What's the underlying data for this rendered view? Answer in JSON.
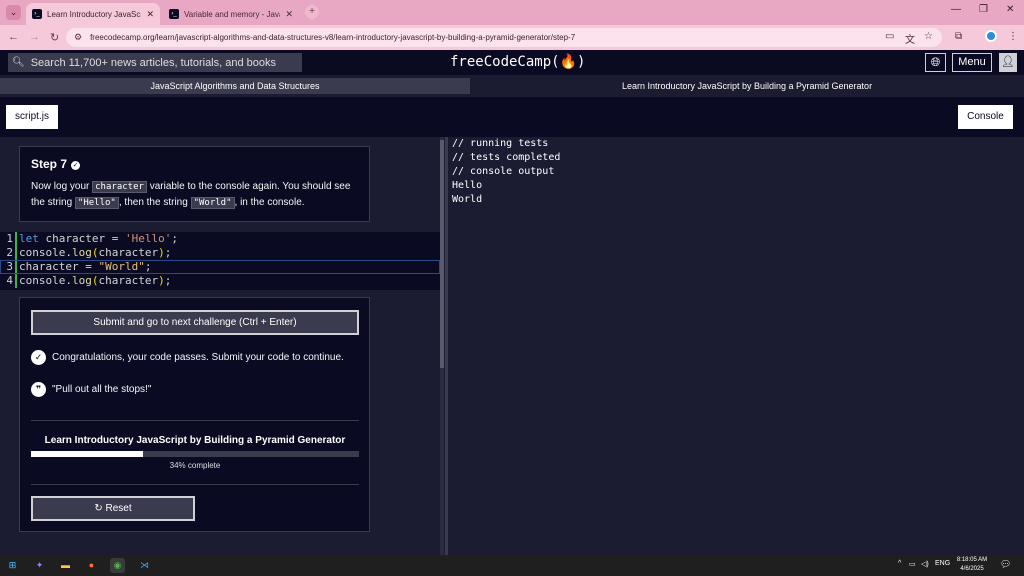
{
  "browser": {
    "tabs": [
      {
        "title": "Learn Introductory JavaScript b",
        "active": true
      },
      {
        "title": "Variable and memory - JavaScri",
        "active": false
      }
    ],
    "url": "freecodecamp.org/learn/javascript-algorithms-and-data-structures-v8/learn-introductory-javascript-by-building-a-pyramid-generator/step-7"
  },
  "nav": {
    "search_placeholder": "Search 11,700+ news articles, tutorials, and books",
    "logo": "freeCodeCamp(🔥)",
    "menu_label": "Menu"
  },
  "breadcrumbs": {
    "superblock": "JavaScript Algorithms and Data Structures",
    "block": "Learn Introductory JavaScript by Building a Pyramid Generator"
  },
  "tabs": {
    "file": "script.js",
    "console": "Console"
  },
  "instructions": {
    "step_title": "Step 7",
    "text_1": "Now log your ",
    "code_1": "character",
    "text_2": " variable to the console again. You should see the string ",
    "code_2": "\"Hello\"",
    "text_3": ", then the string ",
    "code_3": "\"World\"",
    "text_4": ", in the console."
  },
  "editor": {
    "line_numbers": [
      "1",
      "2",
      "3",
      "4"
    ],
    "line1": {
      "kw": "let",
      "rest": " character = ",
      "str": "'Hello'",
      "end": ";"
    },
    "line2": {
      "obj": "console.",
      "fn": "log",
      "open": "(",
      "arg": "character",
      "close": ")",
      "end": ";"
    },
    "line3": {
      "lhs": "character = ",
      "str": "\"World\"",
      "end": ";"
    },
    "line4": {
      "obj": "console.",
      "fn": "log",
      "open": "(",
      "arg": "character",
      "close": ")",
      "end": ";"
    }
  },
  "actions": {
    "submit_label": "Submit and go to next challenge (Ctrl + Enter)",
    "success_message": "Congratulations, your code passes. Submit your code to continue.",
    "quote": "\"Pull out all the stops!\"",
    "progress_title": "Learn Introductory JavaScript by Building a Pyramid Generator",
    "progress_percent": 34,
    "progress_label": "34% complete",
    "reset_label": "Reset"
  },
  "console": {
    "lines": [
      "// running tests",
      "// tests completed",
      "// console output",
      "Hello",
      "World"
    ]
  },
  "taskbar": {
    "lang": "ENG",
    "time": "8:18:05 AM",
    "date": "4/6/2025"
  },
  "colors": {
    "fcc_dark": "#0a0a23",
    "fcc_bg": "#1b1b32",
    "fcc_gray": "#3b3b4f",
    "browser_frame": "#e8a7c2",
    "gutter_green": "#3eb34a"
  }
}
